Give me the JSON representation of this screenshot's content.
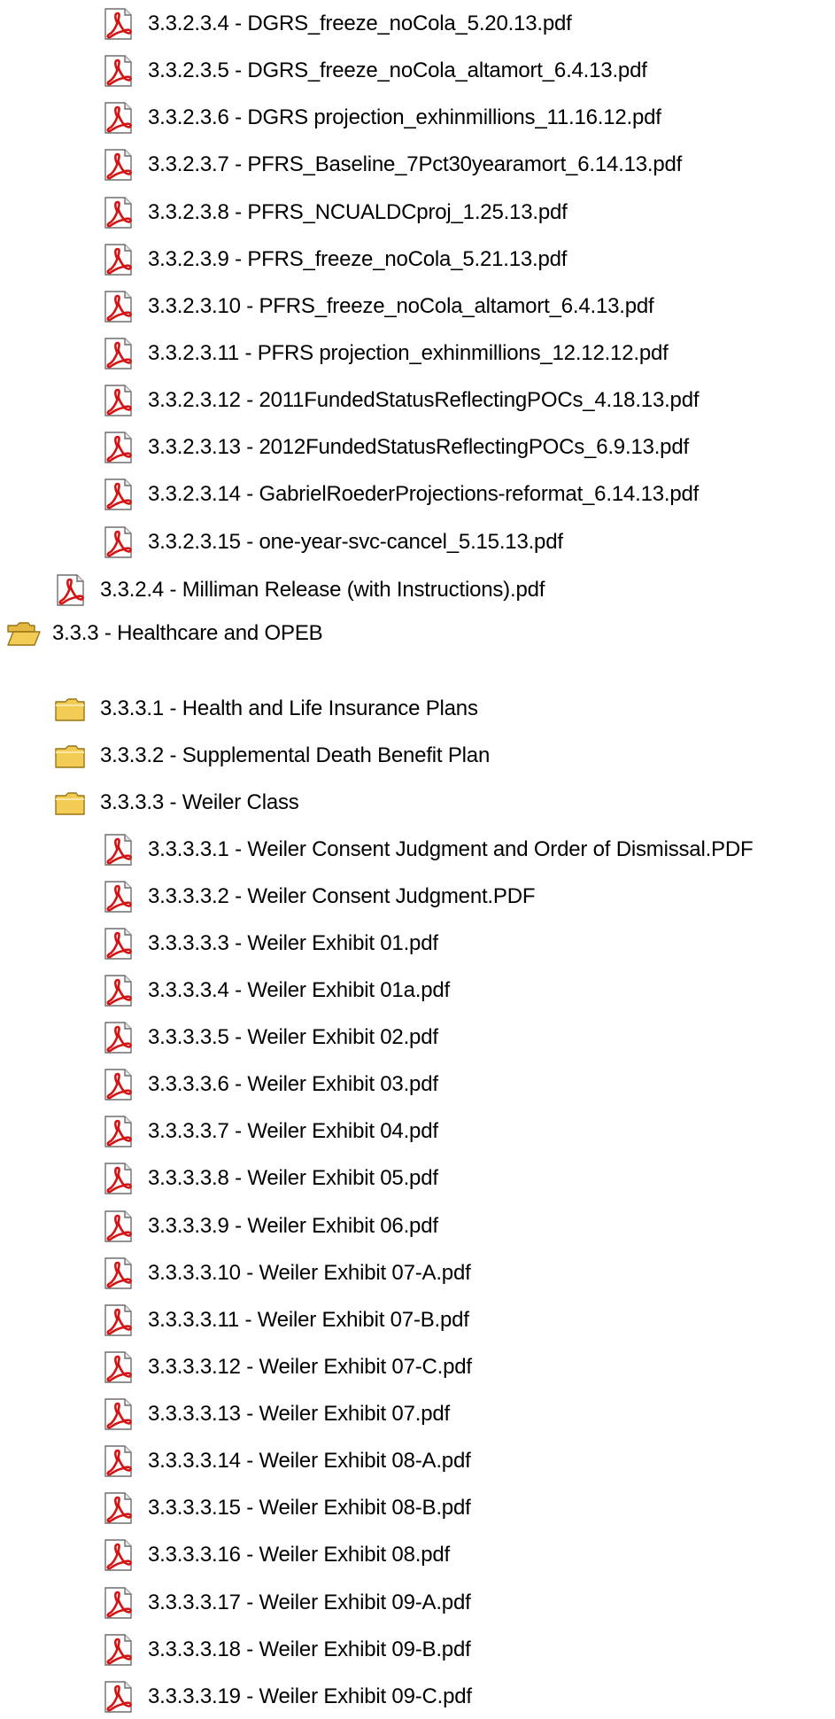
{
  "tree": {
    "items": [
      {
        "type": "file",
        "icon": "pdf-file-icon",
        "label": "3.3.2.3.4 - DGRS_freeze_noCola_5.20.13.pdf"
      },
      {
        "type": "file",
        "icon": "pdf-file-icon",
        "label": "3.3.2.3.5 - DGRS_freeze_noCola_altamort_6.4.13.pdf"
      },
      {
        "type": "file",
        "icon": "pdf-file-icon",
        "label": "3.3.2.3.6 - DGRS projection_exhinmillions_11.16.12.pdf"
      },
      {
        "type": "file",
        "icon": "pdf-file-icon",
        "label": "3.3.2.3.7 - PFRS_Baseline_7Pct30yearamort_6.14.13.pdf"
      },
      {
        "type": "file",
        "icon": "pdf-file-icon",
        "label": "3.3.2.3.8 - PFRS_NCUALDCproj_1.25.13.pdf"
      },
      {
        "type": "file",
        "icon": "pdf-file-icon",
        "label": "3.3.2.3.9 - PFRS_freeze_noCola_5.21.13.pdf"
      },
      {
        "type": "file",
        "icon": "pdf-file-icon",
        "label": "3.3.2.3.10 - PFRS_freeze_noCola_altamort_6.4.13.pdf"
      },
      {
        "type": "file",
        "icon": "pdf-file-icon",
        "label": "3.3.2.3.11 - PFRS projection_exhinmillions_12.12.12.pdf"
      },
      {
        "type": "file",
        "icon": "pdf-file-icon",
        "label": "3.3.2.3.12 - 2011FundedStatusReflectingPOCs_4.18.13.pdf"
      },
      {
        "type": "file",
        "icon": "pdf-file-icon",
        "label": "3.3.2.3.13 - 2012FundedStatusReflectingPOCs_6.9.13.pdf"
      },
      {
        "type": "file",
        "icon": "pdf-file-icon",
        "label": "3.3.2.3.14 - GabrielRoederProjections-reformat_6.14.13.pdf"
      },
      {
        "type": "file",
        "icon": "pdf-file-icon",
        "label": "3.3.2.3.15 - one-year-svc-cancel_5.15.13.pdf"
      },
      {
        "type": "file",
        "icon": "pdf-file-icon",
        "label": "3.3.2.4 - Milliman Release (with Instructions).pdf"
      },
      {
        "type": "folder-open",
        "icon": "folder-open-icon",
        "label": "3.3.3 - Healthcare and OPEB"
      },
      {
        "type": "folder",
        "icon": "folder-icon",
        "label": "3.3.3.1 - Health and Life Insurance Plans"
      },
      {
        "type": "folder",
        "icon": "folder-icon",
        "label": "3.3.3.2 - Supplemental Death Benefit Plan"
      },
      {
        "type": "folder",
        "icon": "folder-icon",
        "label": "3.3.3.3 - Weiler Class"
      },
      {
        "type": "file",
        "icon": "pdf-file-icon",
        "label": "3.3.3.3.1 - Weiler Consent Judgment and Order of Dismissal.PDF"
      },
      {
        "type": "file",
        "icon": "pdf-file-icon",
        "label": "3.3.3.3.2 - Weiler Consent Judgment.PDF"
      },
      {
        "type": "file",
        "icon": "pdf-file-icon",
        "label": "3.3.3.3.3 - Weiler Exhibit 01.pdf"
      },
      {
        "type": "file",
        "icon": "pdf-file-icon",
        "label": "3.3.3.3.4 - Weiler Exhibit 01a.pdf"
      },
      {
        "type": "file",
        "icon": "pdf-file-icon",
        "label": "3.3.3.3.5 - Weiler Exhibit 02.pdf"
      },
      {
        "type": "file",
        "icon": "pdf-file-icon",
        "label": "3.3.3.3.6 - Weiler Exhibit 03.pdf"
      },
      {
        "type": "file",
        "icon": "pdf-file-icon",
        "label": "3.3.3.3.7 - Weiler Exhibit 04.pdf"
      },
      {
        "type": "file",
        "icon": "pdf-file-icon",
        "label": "3.3.3.3.8 - Weiler Exhibit 05.pdf"
      },
      {
        "type": "file",
        "icon": "pdf-file-icon",
        "label": "3.3.3.3.9 - Weiler Exhibit 06.pdf"
      },
      {
        "type": "file",
        "icon": "pdf-file-icon",
        "label": "3.3.3.3.10 - Weiler Exhibit 07-A.pdf"
      },
      {
        "type": "file",
        "icon": "pdf-file-icon",
        "label": "3.3.3.3.11 - Weiler Exhibit 07-B.pdf"
      },
      {
        "type": "file",
        "icon": "pdf-file-icon",
        "label": "3.3.3.3.12 - Weiler Exhibit 07-C.pdf"
      },
      {
        "type": "file",
        "icon": "pdf-file-icon",
        "label": "3.3.3.3.13 - Weiler Exhibit 07.pdf"
      },
      {
        "type": "file",
        "icon": "pdf-file-icon",
        "label": "3.3.3.3.14 - Weiler Exhibit 08-A.pdf"
      },
      {
        "type": "file",
        "icon": "pdf-file-icon",
        "label": "3.3.3.3.15 - Weiler Exhibit 08-B.pdf"
      },
      {
        "type": "file",
        "icon": "pdf-file-icon",
        "label": "3.3.3.3.16 - Weiler Exhibit 08.pdf"
      },
      {
        "type": "file",
        "icon": "pdf-file-icon",
        "label": "3.3.3.3.17 - Weiler Exhibit 09-A.pdf"
      },
      {
        "type": "file",
        "icon": "pdf-file-icon",
        "label": "3.3.3.3.18 - Weiler Exhibit 09-B.pdf"
      },
      {
        "type": "file",
        "icon": "pdf-file-icon",
        "label": "3.3.3.3.19 - Weiler Exhibit 09-C.pdf"
      }
    ]
  },
  "colors": {
    "pdf_red": "#d41414",
    "folder_yellow": "#f2cc55",
    "folder_outline": "#9a7414",
    "text": "#000000"
  }
}
